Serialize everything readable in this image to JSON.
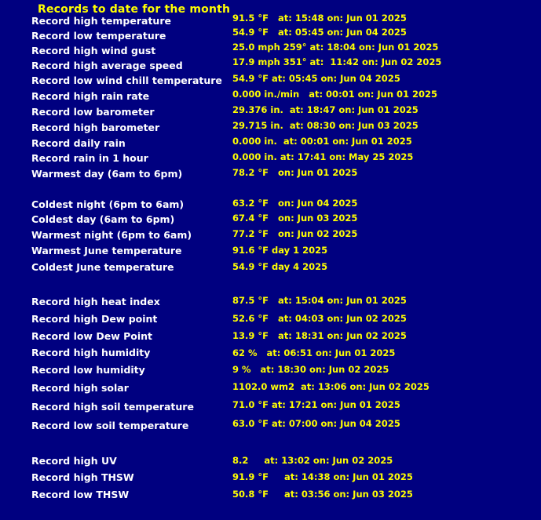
{
  "title": "Records to date for the month",
  "colors": {
    "background": "#000080",
    "label": "#ffffff",
    "value": "#ffff00",
    "title": "#ffff00"
  },
  "records": [
    {
      "label": "Record high temperature",
      "value": "91.5 °F   at: 15:48 on: Jun 01 2025"
    },
    {
      "label": "Record low temperature",
      "value": "54.9 °F   at: 05:45 on: Jun 04 2025"
    },
    {
      "label": "Record high wind gust",
      "value": "25.0 mph 259° at: 18:04 on: Jun 01 2025"
    },
    {
      "label": "Record high average speed",
      "value": "17.9 mph 351° at:  11:42 on: Jun 02 2025"
    },
    {
      "label": "Record low wind chill temperature",
      "value": "54.9 °F at: 05:45 on: Jun 04 2025"
    },
    {
      "label": "Record high rain rate",
      "value": "0.000 in./min   at: 00:01 on: Jun 01 2025"
    },
    {
      "label": "Record low barometer",
      "value": "29.376 in.  at: 18:47 on: Jun 01 2025"
    },
    {
      "label": "Record high barometer",
      "value": "29.715 in.  at: 08:30 on: Jun 03 2025"
    },
    {
      "label": "Record daily rain",
      "value": "0.000 in.  at: 00:01 on: Jun 01 2025"
    },
    {
      "label": "Record rain in 1 hour",
      "value": "0.000 in. at: 17:41 on: May 25 2025"
    },
    {
      "label": "Warmest day (6am to 6pm)",
      "value": "78.2 °F   on: Jun 01 2025"
    },
    {
      "label": "Coldest night (6pm to 6am)",
      "value": "63.2 °F   on: Jun 04 2025"
    },
    {
      "label": "Coldest day (6am to 6pm)",
      "value": "67.4 °F   on: Jun 03 2025"
    },
    {
      "label": "Warmest night (6pm to 6am)",
      "value": "77.2 °F   on: Jun 02 2025"
    },
    {
      "label": "Warmest June temperature",
      "value": "91.6 °F day 1 2025"
    },
    {
      "label": "Coldest June temperature",
      "value": "54.9 °F day 4 2025"
    },
    {
      "label": "Record high heat index",
      "value": "87.5 °F   at: 15:04 on: Jun 01 2025"
    },
    {
      "label": "Record high Dew point",
      "value": "52.6 °F   at: 04:03 on: Jun 02 2025"
    },
    {
      "label": "Record low Dew Point",
      "value": "13.9 °F   at: 18:31 on: Jun 02 2025"
    },
    {
      "label": "Record high humidity",
      "value": "62 %   at: 06:51 on: Jun 01 2025"
    },
    {
      "label": "Record low humidity",
      "value": "9 %   at: 18:30 on: Jun 02 2025"
    },
    {
      "label": "Record high solar",
      "value": "1102.0 wm2  at: 13:06 on: Jun 02 2025"
    },
    {
      "label": "Record high soil temperature",
      "value": "71.0 °F at: 17:21 on: Jun 01 2025"
    },
    {
      "label": "Record low soil temperature",
      "value": "63.0 °F at: 07:00 on: Jun 04 2025"
    },
    {
      "label": "Record high UV",
      "value": "8.2     at: 13:02 on: Jun 02 2025"
    },
    {
      "label": "Record high THSW",
      "value": "91.9 °F     at: 14:38 on: Jun 01 2025"
    },
    {
      "label": "Record low THSW",
      "value": "50.8 °F     at: 03:56 on: Jun 03 2025"
    }
  ]
}
